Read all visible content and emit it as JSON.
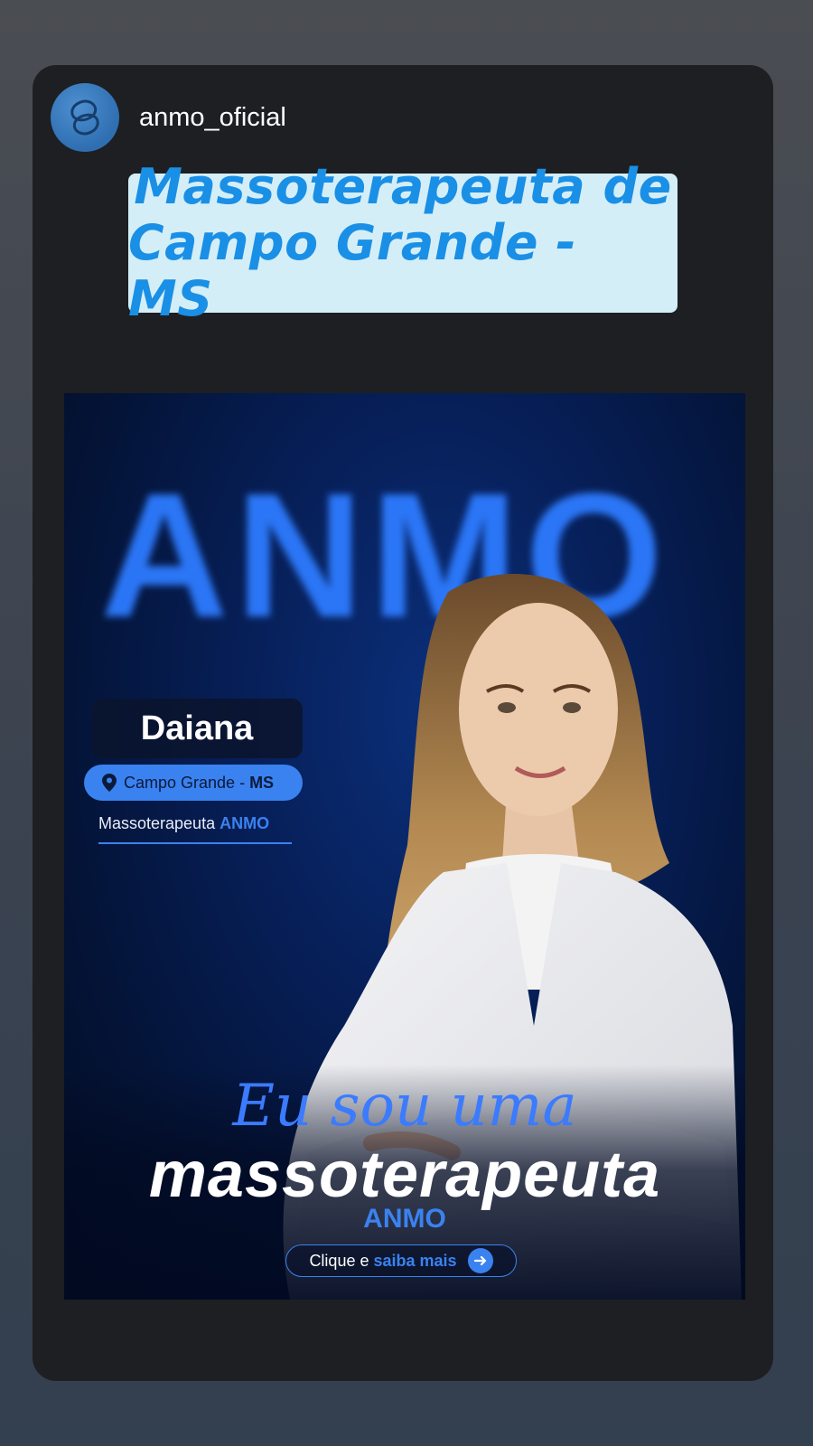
{
  "story": {
    "username": "anmo_oficial",
    "avatar_icon": "anmo-logo-icon"
  },
  "banner": {
    "line1": "Massoterapeuta de",
    "line2": "Campo Grande - MS"
  },
  "post": {
    "background_brand": "ANMO",
    "name": "Daiana",
    "location_city": "Campo Grande -",
    "location_state": "MS",
    "role_prefix": "Massoterapeuta",
    "role_brand": "ANMO",
    "headline_script": "Eu sou uma",
    "headline_main": "massoterapeuta",
    "headline_brand": "ANMO",
    "cta_prefix": "Clique e",
    "cta_highlight": "saiba mais"
  },
  "colors": {
    "accent_blue": "#3a82f0",
    "banner_bg": "#d4eef7",
    "banner_text": "#1a8fe6",
    "card_bg": "#1d1f22"
  }
}
